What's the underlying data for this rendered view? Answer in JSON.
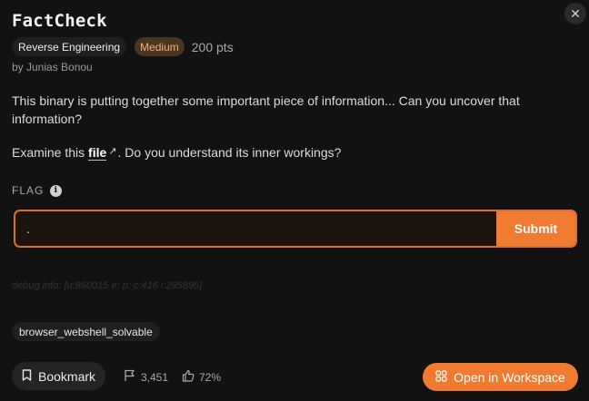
{
  "challenge": {
    "title": "FactCheck",
    "category": "Reverse Engineering",
    "difficulty": "Medium",
    "points": "200 pts",
    "author": "by Junias Bonou",
    "description": "This binary is putting together some important piece of information... Can you uncover that information?",
    "examine_prefix": "Examine this ",
    "file_link": "file",
    "examine_suffix": ". Do you understand its inner workings?"
  },
  "flag": {
    "label": "FLAG",
    "value": ".",
    "submit_label": "Submit"
  },
  "debug_info": "debug info: [u:860015 e: p: c:416 i:295895]",
  "tags": [
    "browser_webshell_solvable"
  ],
  "footer": {
    "bookmark_label": "Bookmark",
    "solves": "3,451",
    "rating": "72%",
    "workspace_label": "Open in Workspace"
  },
  "colors": {
    "accent": "#f07a30",
    "difficulty_medium": "#f3b27a",
    "background": "#121212"
  },
  "icons": {
    "close": "close-icon",
    "external": "external-link-icon",
    "info": "info-icon",
    "bookmark": "bookmark-icon",
    "flag": "flag-icon",
    "thumbs_up": "thumbs-up-icon",
    "workspace": "workspace-icon"
  }
}
